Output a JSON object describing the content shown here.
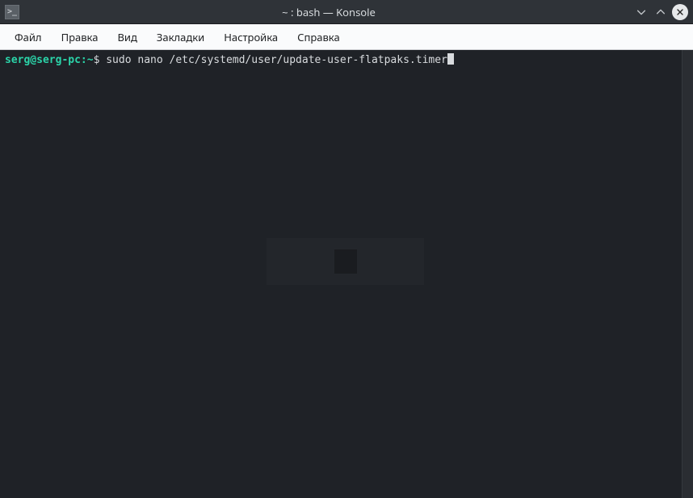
{
  "window": {
    "app_icon_glyph": ">_",
    "title": "~ : bash — Konsole"
  },
  "menu": {
    "items": [
      "Файл",
      "Правка",
      "Вид",
      "Закладки",
      "Настройка",
      "Справка"
    ]
  },
  "terminal": {
    "prompt": {
      "userhost": "serg@serg-pc",
      "sep": ":",
      "path": "~",
      "symbol": "$"
    },
    "command": "sudo nano /etc/systemd/user/update-user-flatpaks.timer"
  },
  "colors": {
    "prompt_user": "#2bd4a9",
    "terminal_bg": "#1f2227",
    "terminal_fg": "#d8dbde",
    "titlebar_bg": "#2f3338",
    "menubar_bg": "#fafbfc"
  }
}
